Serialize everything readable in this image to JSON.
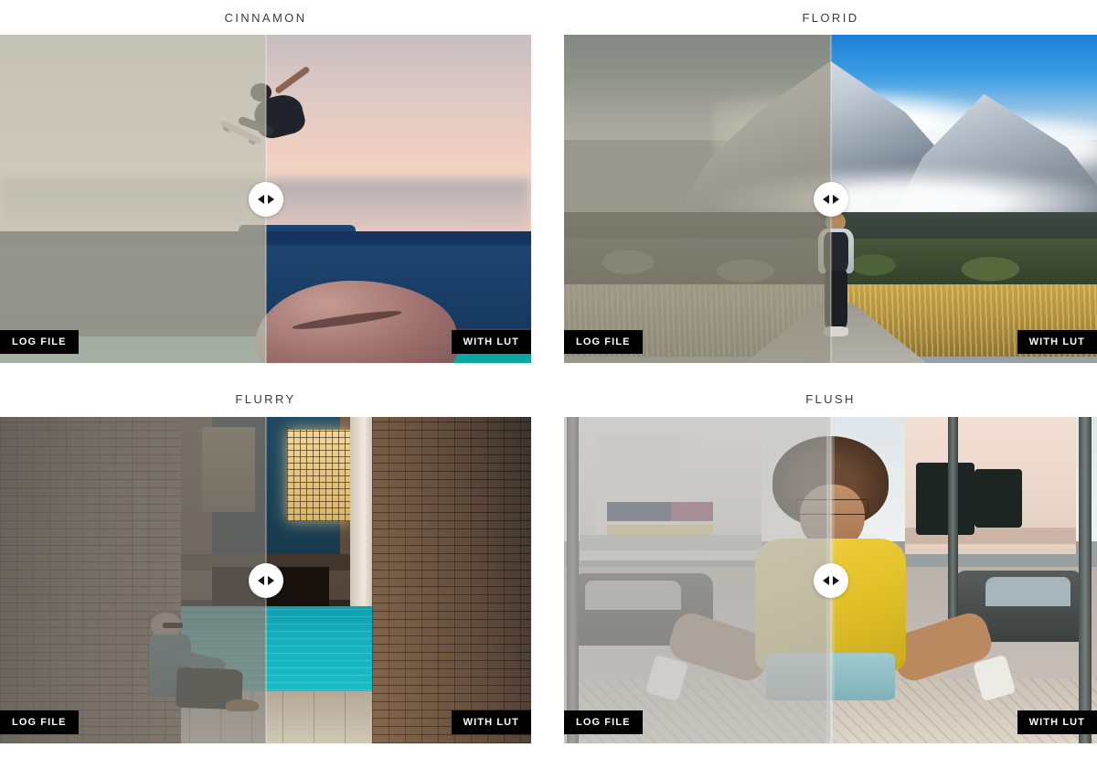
{
  "page": {
    "background": "#ffffff",
    "accent_badge_bg": "#000000",
    "badge_text_color": "#ffffff"
  },
  "labels": {
    "before": "LOG FILE",
    "after": "WITH LUT"
  },
  "cards": [
    {
      "title": "CINNAMON",
      "before_label": "LOG FILE",
      "after_label": "WITH LUT",
      "handle_icon": "left-right-arrows-icon",
      "slider_position": "50%",
      "scene": "skateboarder jumping in front of a painted wall at sunset",
      "after_colors": [
        "#f0cfc2",
        "#1d4470",
        "#0aa8a2"
      ]
    },
    {
      "title": "FLORID",
      "before_label": "LOG FILE",
      "after_label": "WITH LUT",
      "handle_icon": "left-right-arrows-icon",
      "slider_position": "50%",
      "scene": "hiker walking a path toward snowy mountains",
      "after_colors": [
        "#1c7fd6",
        "#37472e",
        "#c5a14a"
      ]
    },
    {
      "title": "FLURRY",
      "before_label": "LOG FILE",
      "after_label": "WITH LUT",
      "handle_icon": "left-right-arrows-icon",
      "slider_position": "50%",
      "scene": "man sitting beside a turquoise Venice canal",
      "after_colors": [
        "#7d5c3e",
        "#16c0c6",
        "#3c7d96"
      ]
    },
    {
      "title": "FLUSH",
      "before_label": "LOG FILE",
      "after_label": "WITH LUT",
      "handle_icon": "left-right-arrows-icon",
      "slider_position": "50%",
      "scene": "woman in a yellow dress mirrored on a city street",
      "after_colors": [
        "#f2d23f",
        "#e3cec2",
        "#7fb2bb"
      ]
    }
  ]
}
